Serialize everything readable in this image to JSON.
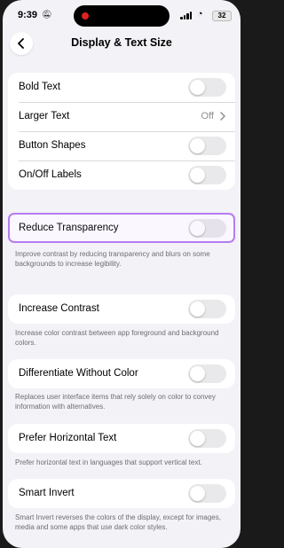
{
  "status_bar": {
    "time": "9:39",
    "battery": "32"
  },
  "nav": {
    "title": "Display & Text Size"
  },
  "group1": {
    "rows": [
      {
        "label": "Bold Text",
        "toggle_on": false
      },
      {
        "label": "Larger Text",
        "value": "Off"
      },
      {
        "label": "Button Shapes",
        "toggle_on": false
      },
      {
        "label": "On/Off Labels",
        "toggle_on": false
      }
    ]
  },
  "reduce_transparency": {
    "label": "Reduce Transparency",
    "toggle_on": false,
    "description": "Improve contrast by reducing transparency and blurs on some backgrounds to increase legibility."
  },
  "increase_contrast": {
    "label": "Increase Contrast",
    "toggle_on": false,
    "description": "Increase color contrast between app foreground and background colors."
  },
  "differentiate": {
    "label": "Differentiate Without Color",
    "toggle_on": false,
    "description": "Replaces user interface items that rely solely on color to convey information with alternatives."
  },
  "horizontal_text": {
    "label": "Prefer Horizontal Text",
    "toggle_on": false,
    "description": "Prefer horizontal text in languages that support vertical text."
  },
  "smart_invert": {
    "label": "Smart Invert",
    "toggle_on": false,
    "description": "Smart Invert reverses the colors of the display, except for images, media and some apps that use dark color styles."
  },
  "colors": {
    "highlight": "#b57cf2",
    "toggle_off": "#e9e9eb",
    "background": "#f2f2f7"
  }
}
